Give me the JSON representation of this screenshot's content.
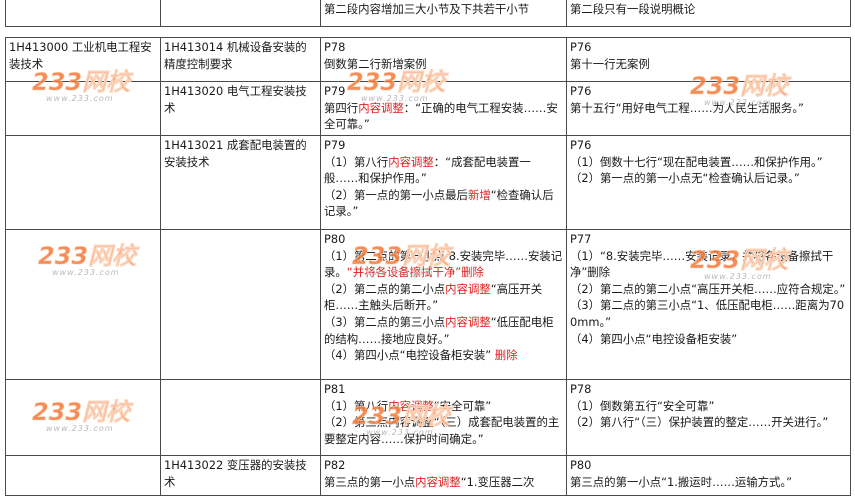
{
  "header": {
    "col3": "第二段内容增加三大小节及下共若干小节",
    "col4": "第二段只有一段说明概论"
  },
  "rows": [
    {
      "section": "1H413000 工业机电工程安装技术",
      "subsection": "1H413014 机械设备安装的精度控制要求",
      "new_lines": [
        [
          {
            "t": "P78"
          }
        ],
        [
          {
            "t": "倒数第二行新增案例"
          }
        ]
      ],
      "old_lines": [
        [
          {
            "t": "P76"
          }
        ],
        [
          {
            "t": "第十一行无案例"
          }
        ]
      ]
    },
    {
      "section": "",
      "subsection": "1H413020 电气工程安装技术",
      "new_lines": [
        [
          {
            "t": "P79"
          }
        ],
        [
          {
            "t": "第四行"
          },
          {
            "t": "内容调整",
            "red": true
          },
          {
            "t": "：“正确的电气工程安装……安全可靠。”"
          }
        ]
      ],
      "old_lines": [
        [
          {
            "t": "P76"
          }
        ],
        [
          {
            "t": "第十五行“用好电气工程……为人民生活服务。”"
          }
        ]
      ]
    },
    {
      "section": "",
      "subsection": "1H413021 成套配电装置的安装技术",
      "new_lines": [
        [
          {
            "t": "P79"
          }
        ],
        [
          {
            "t": "（1）第八行"
          },
          {
            "t": "内容调整",
            "red": true
          },
          {
            "t": "：“成套配电装置一般……和保护作用。”"
          }
        ],
        [
          {
            "t": "（2）第一点的第一小点最后"
          },
          {
            "t": "新增",
            "red": true
          },
          {
            "t": "“检查确认后记录。”"
          }
        ]
      ],
      "old_lines": [
        [
          {
            "t": "P76"
          }
        ],
        [
          {
            "t": "（1）倒数十七行“现在配电装置……和保护作用。”"
          }
        ],
        [
          {
            "t": "（2）第一点的第一小点无“检查确认后记录。”"
          }
        ]
      ]
    },
    {
      "section": "",
      "subsection": "",
      "new_lines": [
        [
          {
            "t": "P80"
          }
        ],
        [
          {
            "t": "（1）第二点的第一小点 8.安装完毕……安装记录。"
          },
          {
            "t": "“并将各设备擦拭干净”删除",
            "red": true
          }
        ],
        [
          {
            "t": "（2）第二点的第二小点"
          },
          {
            "t": "内容调整",
            "red": true
          },
          {
            "t": "“高压开关柜……主触头后断开。”"
          }
        ],
        [
          {
            "t": "（3）第二点的第三小点"
          },
          {
            "t": "内容调整",
            "red": true
          },
          {
            "t": "“低压配电柜的结构……接地应良好。”"
          }
        ],
        [
          {
            "t": "（4）第四小点“电控设备柜安装” "
          },
          {
            "t": "删除",
            "red": true
          }
        ]
      ],
      "old_lines": [
        [
          {
            "t": "P77"
          }
        ],
        [
          {
            "t": "（1）“8.安装完毕……安装记录，并将各设备擦拭干净”删除"
          }
        ],
        [
          {
            "t": "（2）第二点的第二小点“高压开关柜……应符合规定。”"
          }
        ],
        [
          {
            "t": "（3）第二点的第三小点“1、低压配电柜……距离为700mm。”"
          }
        ],
        [
          {
            "t": "（4）第四小点“电控设备柜安装”"
          }
        ]
      ]
    },
    {
      "section": "",
      "subsection": "",
      "new_lines": [
        [
          {
            "t": "P81"
          }
        ],
        [
          {
            "t": "（1）第八行"
          },
          {
            "t": "内容调整",
            "red": true
          },
          {
            "t": "“安全可靠”"
          }
        ],
        [
          {
            "t": "（2）第三点内容调整“（三）成套配电装置的主要整定内容……保护时间确定。”"
          }
        ]
      ],
      "old_lines": [
        [
          {
            "t": "P78"
          }
        ],
        [
          {
            "t": "（1）倒数第五行“安全可靠”"
          }
        ],
        [
          {
            "t": "（2）第八行“（三）保护装置的整定……开关进行。”"
          }
        ]
      ]
    },
    {
      "section": "",
      "subsection": "1H413022 变压器的安装技术",
      "new_lines": [
        [
          {
            "t": "P82"
          }
        ],
        [
          {
            "t": "第三点的第一小点"
          },
          {
            "t": "内容调整",
            "red": true
          },
          {
            "t": "“1.变压器二次"
          }
        ]
      ],
      "old_lines": [
        [
          {
            "t": "P80"
          }
        ],
        [
          {
            "t": "第三点的第一小点“1.搬运时……运输方式。”"
          }
        ]
      ]
    }
  ],
  "watermarks": [
    {
      "logo": "233网校",
      "url": "www.233.com"
    },
    {
      "logo": "233网校",
      "url": "www.233.com"
    },
    {
      "logo": "233网校",
      "url": "www.233.com"
    },
    {
      "logo": "233网校",
      "url": "www.233.com"
    },
    {
      "logo": "233网校",
      "url": "www.233.com"
    },
    {
      "logo": "233网校",
      "url": "www.233.com"
    },
    {
      "logo": "233网校",
      "url": "www.233.com"
    },
    {
      "logo": "233网校",
      "url": "www.233.com"
    }
  ],
  "colors": {
    "watermark": "#f4793a",
    "highlight": "#e02020"
  }
}
